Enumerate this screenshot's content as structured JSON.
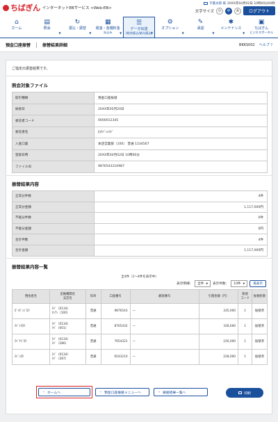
{
  "header": {
    "logo_text": "ちばぎん",
    "service_name": "インターネットEBサービス <Web-EB>",
    "user": "千葉太郎 様",
    "last_login": "20XX年04月02日 10時00分00秒",
    "font_size_label": "文字サイズ",
    "font_small": "小",
    "font_medium": "中",
    "font_large": "大",
    "logout": "ログアウト"
  },
  "nav": [
    {
      "label": "ホーム",
      "sub": "",
      "icon": "home-icon",
      "glyph": "⌂"
    },
    {
      "label": "照会",
      "sub": "",
      "icon": "inquiry-icon",
      "glyph": "▤"
    },
    {
      "label": "振込・振替",
      "sub": "",
      "icon": "transfer-icon",
      "glyph": "↻"
    },
    {
      "label": "税金・各種料金",
      "sub": "払込み",
      "icon": "tax-payment-icon",
      "glyph": "▦"
    },
    {
      "label": "データ伝送",
      "sub": "(総合振込/給与振込)",
      "icon": "data-transmission-icon",
      "glyph": "☰"
    },
    {
      "label": "オプション",
      "sub": "",
      "icon": "option-icon",
      "glyph": "⚙"
    },
    {
      "label": "承認",
      "sub": "",
      "icon": "approval-icon",
      "glyph": "✎"
    },
    {
      "label": "メンテナンス",
      "sub": "",
      "icon": "maintenance-icon",
      "glyph": "✱"
    },
    {
      "label": "ちばぎん",
      "sub": "ビジネスポータル",
      "icon": "portal-icon",
      "glyph": "▣"
    }
  ],
  "title": {
    "crumb1": "預金口座振替",
    "crumb2": "振替結果詳細",
    "screen_id": "BKKS002",
    "help": "ヘルプ"
  },
  "notice": "ご指定の振替結果です。",
  "file_section": {
    "title": "照会対象ファイル",
    "rows": [
      {
        "label": "取引種類",
        "value": "預金口座振替"
      },
      {
        "label": "振替日",
        "value": "20XX年05月20日"
      },
      {
        "label": "委託者コード",
        "value": "0000012345"
      },
      {
        "label": "委託者名",
        "value": "ｶ)ﾁﾊﾞｼｮｳｼﾞ"
      },
      {
        "label": "入金口座",
        "value": "本店営業部（100） 普通 1234567"
      },
      {
        "label": "登録日時",
        "value": "20XX年04月02日 10時00分"
      },
      {
        "label": "ファイルID",
        "value": "9876543210987"
      }
    ]
  },
  "result_section": {
    "title": "振替結果内容",
    "rows": [
      {
        "label": "正常分件数",
        "value": "4件"
      },
      {
        "label": "正常分金額",
        "value": "1,117,000円"
      },
      {
        "label": "不能分件数",
        "value": "0件"
      },
      {
        "label": "不能分金額",
        "value": "0円"
      },
      {
        "label": "合計件数",
        "value": "4件"
      },
      {
        "label": "合計金額",
        "value": "1,117,000円"
      }
    ]
  },
  "list_section": {
    "title": "振替結果内容一覧",
    "summary": "全4件（1〜4件を表示中）",
    "filter_label": "表示明細：",
    "filter_value": "全件",
    "count_label": "表示件数：",
    "count_value": "10件",
    "redisplay": "再表示",
    "headers": [
      "預金者名",
      "金融機関名\n支店名",
      "科目",
      "口座番号",
      "顧客番号",
      "引落金額（円）",
      "新規\nコード",
      "振替結果"
    ],
    "rows": [
      {
        "name": "ｶﾞｲﾀﾞﾝｼﾞﾛｳ",
        "bank": "ﾁﾊﾞ（0134）\nﾎﾝﾃﾝ（100）",
        "type": "普通",
        "account": "9876543",
        "customer": "—",
        "amount": "335,000",
        "code": "1",
        "result": "振替済"
      },
      {
        "name": "ﾁﾊﾞｲﾁﾛｳ",
        "bank": "ﾁﾊﾞ（0134）\nﾁﾊﾞ（001）",
        "type": "普通",
        "account": "8765432",
        "customer": "—",
        "amount": "328,000",
        "code": "1",
        "result": "振替済"
      },
      {
        "name": "ﾁﾊﾞｻﾌﾞﾛｳ",
        "bank": "ﾁﾊﾞ（0134）\nﾁﾊﾞ（286）",
        "type": "普通",
        "account": "7654321",
        "customer": "—",
        "amount": "226,000",
        "code": "1",
        "result": "振替済"
      },
      {
        "name": "ﾁﾊﾞｼﾛｳ",
        "bank": "ﾁﾊﾞ（0134）\nﾁﾊﾞ（287）",
        "type": "普通",
        "account": "6543210",
        "customer": "—",
        "amount": "228,000",
        "code": "1",
        "result": "振替済"
      }
    ]
  },
  "buttons": {
    "home": "ホームへ",
    "menu": "預金口座振替メニューへ",
    "result_list": "振替結果一覧へ",
    "print": "印刷"
  }
}
